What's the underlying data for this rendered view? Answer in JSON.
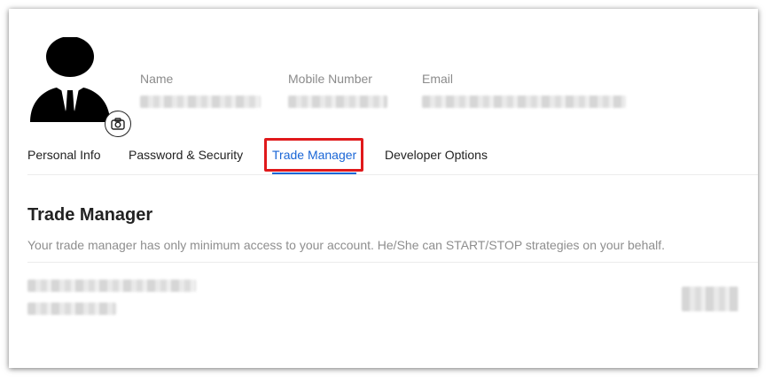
{
  "profile": {
    "avatar_icon": "user-avatar-icon",
    "camera_icon": "camera-icon",
    "fields": [
      {
        "label": "Name"
      },
      {
        "label": "Mobile Number"
      },
      {
        "label": "Email"
      }
    ]
  },
  "tabs": [
    {
      "label": "Personal Info",
      "active": false
    },
    {
      "label": "Password & Security",
      "active": false
    },
    {
      "label": "Trade Manager",
      "active": true
    },
    {
      "label": "Developer Options",
      "active": false
    }
  ],
  "section": {
    "title": "Trade Manager",
    "description": "Your trade manager has only minimum access to your account. He/She can START/STOP strategies on your behalf."
  },
  "colors": {
    "accent": "#1a66d6",
    "highlight": "#e0191b",
    "muted_text": "#8e8e8e"
  }
}
